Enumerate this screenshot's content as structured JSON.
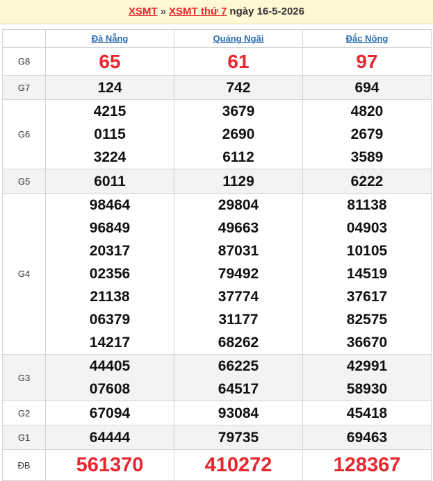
{
  "header": {
    "link1": "XSMT",
    "separator": "»",
    "link2": "XSMT thứ 7",
    "date": "ngày 16-5-2026"
  },
  "provinces": [
    "Đà Nẵng",
    "Quảng Ngãi",
    "Đắc Nông"
  ],
  "rows": [
    {
      "label": "G8",
      "values": [
        [
          "65"
        ],
        [
          "61"
        ],
        [
          "97"
        ]
      ]
    },
    {
      "label": "G7",
      "values": [
        [
          "124"
        ],
        [
          "742"
        ],
        [
          "694"
        ]
      ]
    },
    {
      "label": "G6",
      "values": [
        [
          "4215",
          "0115",
          "3224"
        ],
        [
          "3679",
          "2690",
          "6112"
        ],
        [
          "4820",
          "2679",
          "3589"
        ]
      ]
    },
    {
      "label": "G5",
      "values": [
        [
          "6011"
        ],
        [
          "1129"
        ],
        [
          "6222"
        ]
      ]
    },
    {
      "label": "G4",
      "values": [
        [
          "98464",
          "96849",
          "20317",
          "02356",
          "21138",
          "06379",
          "14217"
        ],
        [
          "29804",
          "49663",
          "87031",
          "79492",
          "37774",
          "31177",
          "68262"
        ],
        [
          "81138",
          "04903",
          "10105",
          "14519",
          "37617",
          "82575",
          "36670"
        ]
      ]
    },
    {
      "label": "G3",
      "values": [
        [
          "44405",
          "07608"
        ],
        [
          "66225",
          "64517"
        ],
        [
          "42991",
          "58930"
        ]
      ]
    },
    {
      "label": "G2",
      "values": [
        [
          "67094"
        ],
        [
          "93084"
        ],
        [
          "45418"
        ]
      ]
    },
    {
      "label": "G1",
      "values": [
        [
          "64444"
        ],
        [
          "79735"
        ],
        [
          "69463"
        ]
      ]
    },
    {
      "label": "ĐB",
      "values": [
        [
          "561370"
        ],
        [
          "410272"
        ],
        [
          "128367"
        ]
      ]
    }
  ]
}
